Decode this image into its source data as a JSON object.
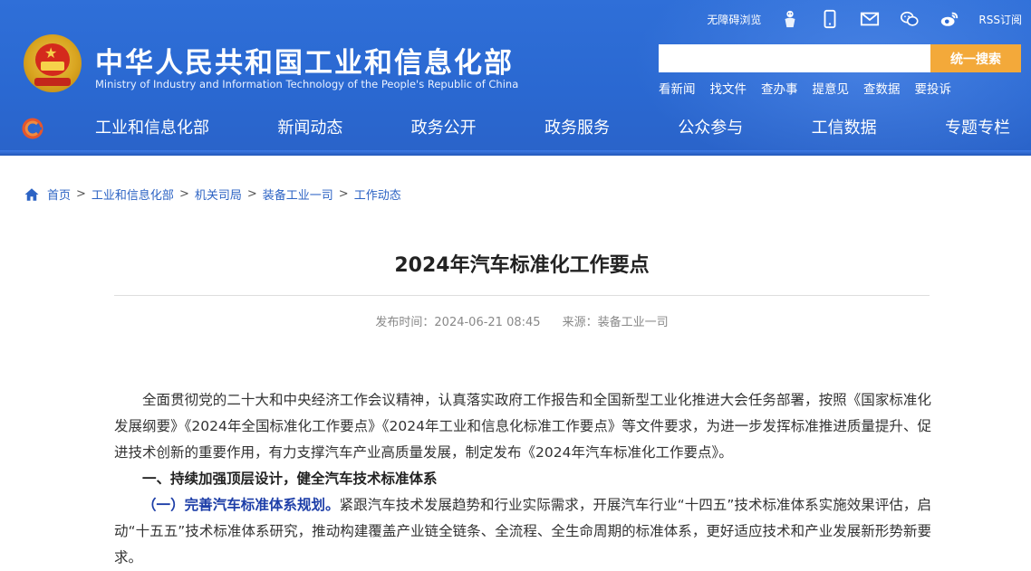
{
  "header": {
    "title": "中华人民共和国工业和信息化部",
    "subtitle": "Ministry of Industry and Information Technology of the People's Republic of China",
    "util": {
      "accessible": "无障碍浏览",
      "rss": "RSS订阅",
      "icons": [
        "accessibility-figure-icon",
        "mobile-icon",
        "mail-icon",
        "wechat-icon",
        "weibo-icon"
      ]
    },
    "search": {
      "placeholder": "",
      "button_label": "统一搜索"
    },
    "quick_links": [
      "看新闻",
      "找文件",
      "查办事",
      "提意见",
      "查数据",
      "要投诉"
    ],
    "nav": [
      "工业和信息化部",
      "新闻动态",
      "政务公开",
      "政务服务",
      "公众参与",
      "工信数据",
      "专题专栏"
    ]
  },
  "breadcrumb": [
    "首页",
    "工业和信息化部",
    "机关司局",
    "装备工业一司",
    "工作动态"
  ],
  "article": {
    "title": "2024年汽车标准化工作要点",
    "publish": "发布时间：2024-06-21 08:45",
    "source": "来源：装备工业一司",
    "p1": "全面贯彻党的二十大和中央经济工作会议精神，认真落实政府工作报告和全国新型工业化推进大会任务部署，按照《国家标准化发展纲要》《2024年全国标准化工作要点》《2024年工业和信息化标准工作要点》等文件要求，为进一步发挥标准推进质量提升、促进技术创新的重要作用，有力支撑汽车产业高质量发展，制定发布《2024年汽车标准化工作要点》。",
    "h1": "一、持续加强顶层设计，健全汽车技术标准体系",
    "p2_lead": "（一）完善汽车标准体系规划。",
    "p2_rest": "紧跟汽车技术发展趋势和行业实际需求，开展汽车行业“十四五”技术标准体系实施效果评估，启动“十五五”技术标准体系研究，推动构建覆盖产业链全链条、全流程、全生命周期的标准体系，更好适应技术和产业发展新形势新要求。"
  },
  "colors": {
    "header_blue": "#2a68d1",
    "search_button": "#f3a93a",
    "link_blue": "#2c63c4",
    "subheading_blue": "#1e3fa8"
  }
}
